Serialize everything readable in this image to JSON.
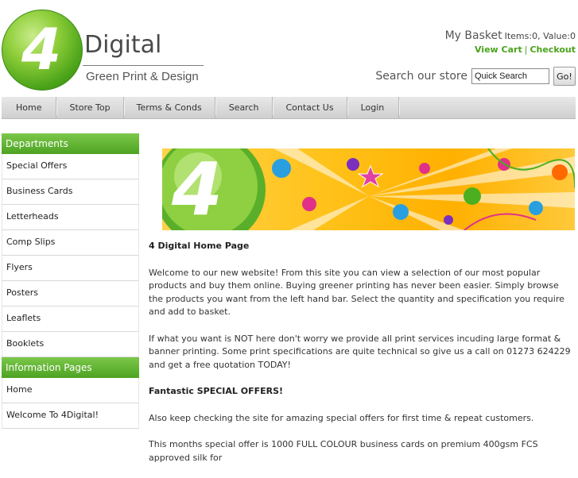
{
  "logo": {
    "mark": "4",
    "name": "Digital",
    "tagline": "Green Print & Design"
  },
  "basket": {
    "title": "My Basket",
    "stats": "Items:0, Value:0",
    "view_cart": "View Cart",
    "separator": "|",
    "checkout": "Checkout"
  },
  "search": {
    "label": "Search our store",
    "placeholder": "Quick Search",
    "button": "Go!"
  },
  "nav": [
    "Home",
    "Store Top",
    "Terms & Conds",
    "Search",
    "Contact Us",
    "Login"
  ],
  "sidebar": {
    "departments_title": "Departments",
    "departments": [
      "Special Offers",
      "Business Cards",
      "Letterheads",
      "Comp Slips",
      "Flyers",
      "Posters",
      "Leaflets",
      "Booklets"
    ],
    "info_title": "Information Pages",
    "info": [
      "Home",
      "Welcome To 4Digital!"
    ]
  },
  "content": {
    "title": "4 Digital Home Page",
    "p1": "Welcome to our new website! From this site you can view a selection of our most popular products and buy them online. Buying greener printing has never been easier. Simply browse the products you want from the left hand bar. Select the quantity and specification you require and add to basket.",
    "p2": "If what you want is NOT here don't worry we provide all print services incuding large format & banner printing. Some print specifications are quite technical so give us a call on 01273 624229 and get a free quotation TODAY!",
    "offers_title": "Fantastic SPECIAL OFFERS!",
    "p3": "Also keep checking the site for amazing special offers for first time & repeat customers.",
    "p4": "This months special offer is 1000 FULL COLOUR business cards on premium 400gsm FCS approved silk for"
  },
  "banner": {
    "mark": "4"
  },
  "colors": {
    "brand_green": "#4ea322",
    "link_green": "#4aa31b",
    "nav_gray": "#d9d9d9"
  }
}
